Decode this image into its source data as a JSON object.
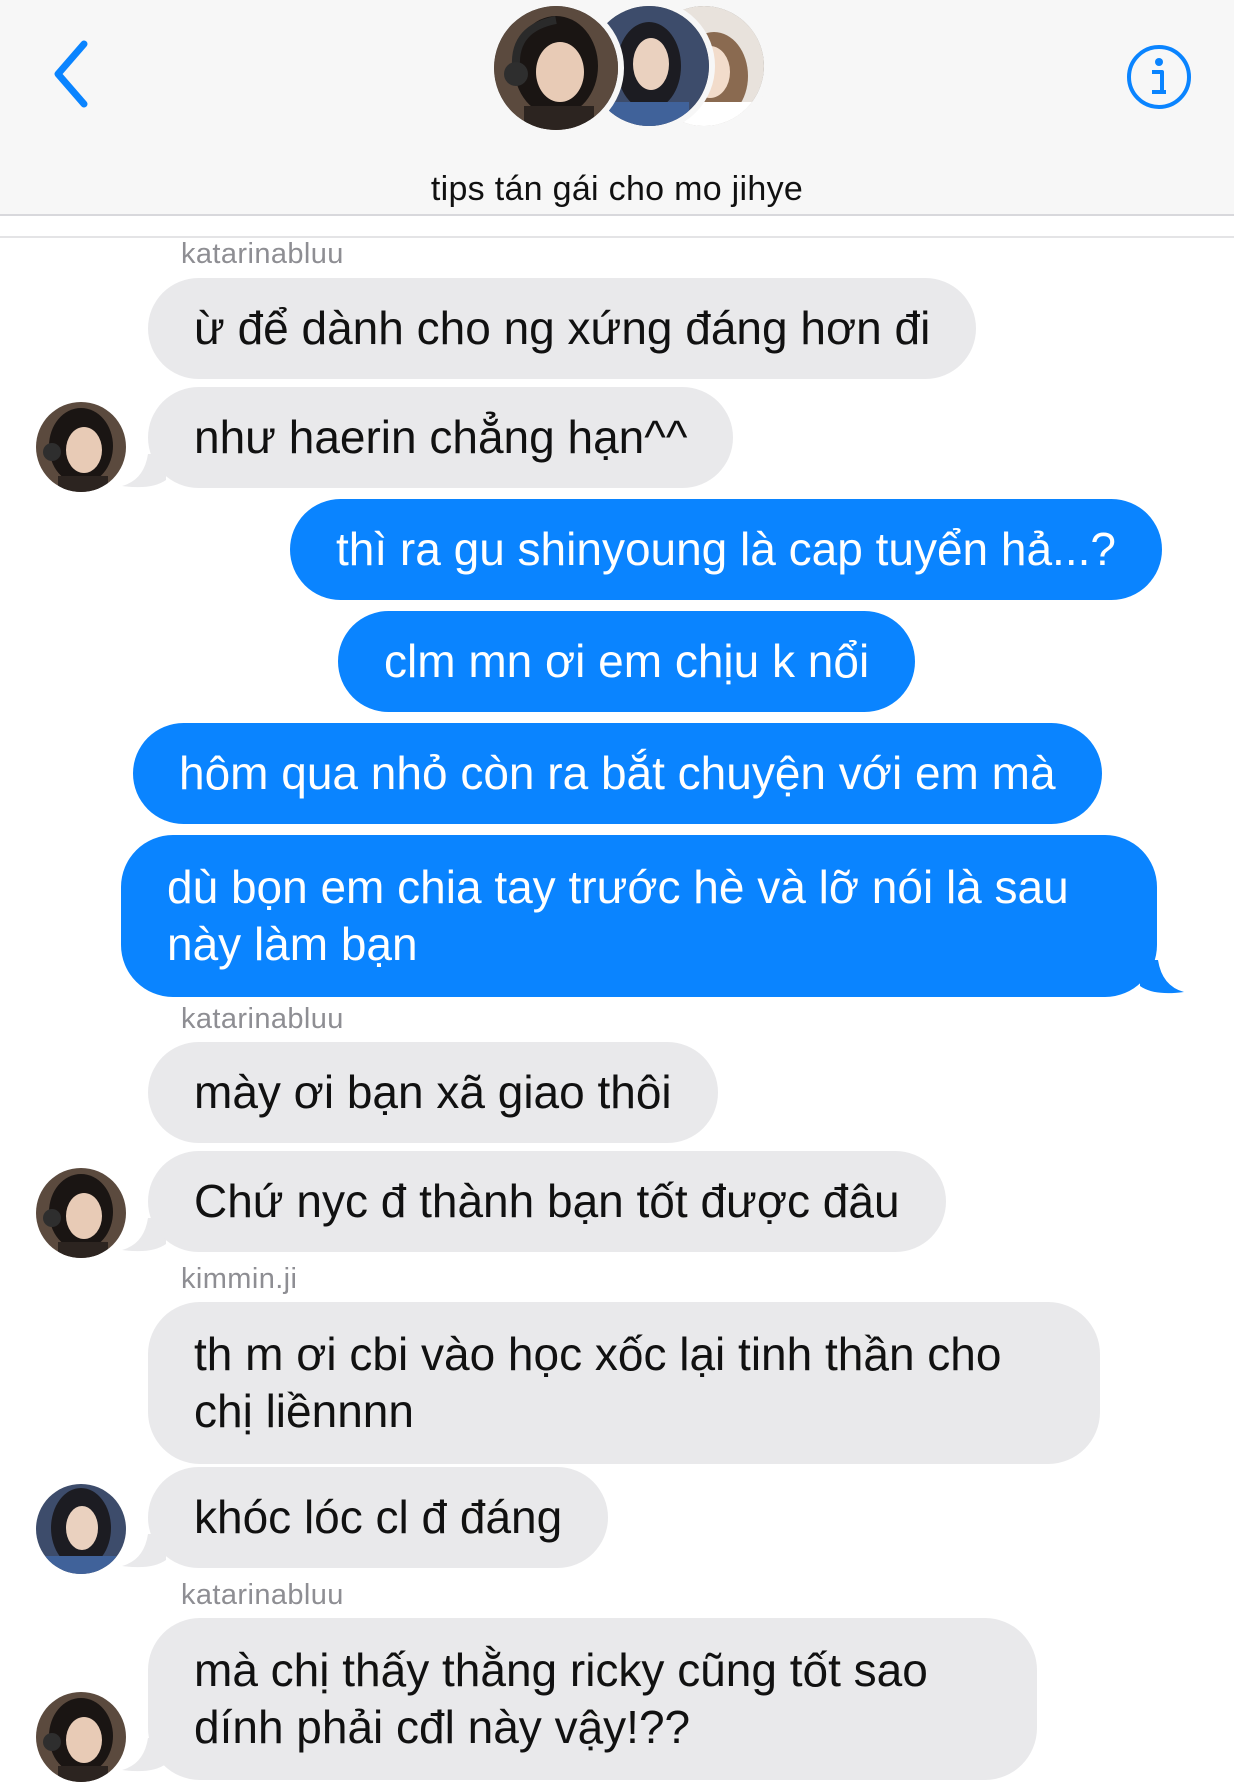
{
  "header": {
    "title": "tips tán gái cho mo jihye",
    "back_icon": "chevron-left-icon",
    "info_icon": "info-icon",
    "accent_color": "#0a84ff"
  },
  "messages": [
    {
      "type": "sender",
      "text": "katarinabluu"
    },
    {
      "type": "in",
      "text": "ừ để dành cho ng xứng đáng hơn đi"
    },
    {
      "type": "in",
      "text": "như haerin chẳng hạn^^"
    },
    {
      "type": "out",
      "text": "thì ra gu shinyoung là cap tuyển hả...?"
    },
    {
      "type": "out",
      "text": "clm mn ơi em chịu k nổi"
    },
    {
      "type": "out",
      "text": "hôm qua nhỏ còn ra bắt chuyện với em mà"
    },
    {
      "type": "out",
      "text": "dù bọn em chia tay trước hè và lỡ nói là sau này làm bạn"
    },
    {
      "type": "sender",
      "text": "katarinabluu"
    },
    {
      "type": "in",
      "text": "mày ơi bạn xã giao thôi"
    },
    {
      "type": "in",
      "text": "Chứ nyc đ thành bạn tốt được đâu"
    },
    {
      "type": "sender",
      "text": "kimmin.ji"
    },
    {
      "type": "in",
      "text": "th m ơi cbi vào học xốc lại tinh thần cho chị liềnnnn"
    },
    {
      "type": "in",
      "text": "khóc lóc cl đ đáng"
    },
    {
      "type": "sender",
      "text": "katarinabluu"
    },
    {
      "type": "in",
      "text": "mà chị thấy thằng ricky cũng tốt sao dính phải cđl này vậy!??"
    }
  ],
  "colors": {
    "incoming_bubble": "#e9e9eb",
    "outgoing_bubble": "#0a84ff",
    "sender_name": "#8e8e93"
  }
}
